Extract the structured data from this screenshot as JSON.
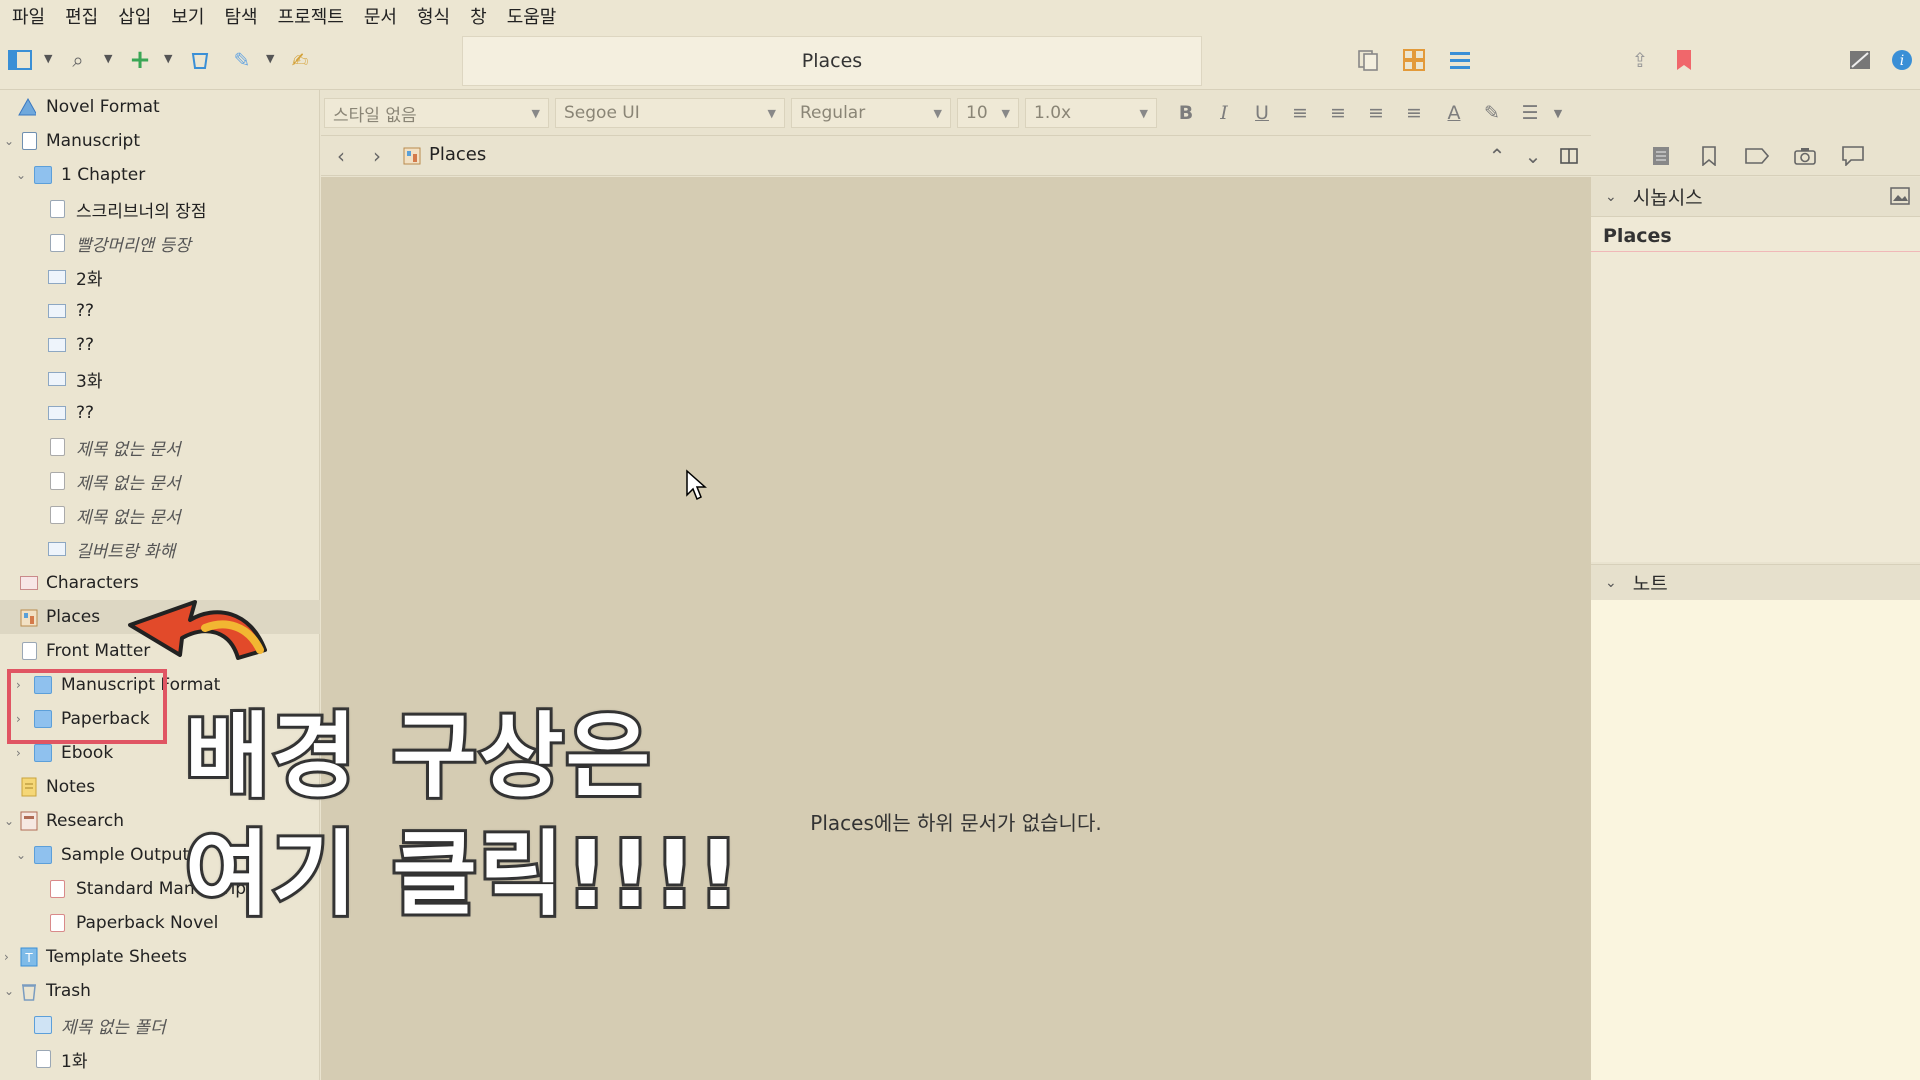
{
  "menu": [
    "파일",
    "편집",
    "삽입",
    "보기",
    "탐색",
    "프로젝트",
    "문서",
    "형식",
    "창",
    "도움말"
  ],
  "window": {
    "title": "Places"
  },
  "binder": {
    "items": [
      {
        "label": "Novel Format",
        "icon": "warning-icon"
      },
      {
        "label": "Manuscript",
        "icon": "manuscript-icon"
      },
      {
        "label": "1 Chapter",
        "icon": "folder-icon"
      },
      {
        "label": "스크리브너의 장점",
        "icon": "document-icon"
      },
      {
        "label": "빨강머리앤 등장",
        "icon": "document-icon"
      },
      {
        "label": "2화",
        "icon": "card-icon"
      },
      {
        "label": "??",
        "icon": "card-icon"
      },
      {
        "label": "??",
        "icon": "card-icon"
      },
      {
        "label": "3화",
        "icon": "card-icon"
      },
      {
        "label": "??",
        "icon": "card-icon"
      },
      {
        "label": "제목 없는 문서",
        "icon": "blank-document-icon"
      },
      {
        "label": "제목 없는 문서",
        "icon": "blank-document-icon"
      },
      {
        "label": "제목 없는 문서",
        "icon": "blank-document-icon"
      },
      {
        "label": "길버트랑 화해",
        "icon": "card-icon"
      },
      {
        "label": "Characters",
        "icon": "characters-icon"
      },
      {
        "label": "Places",
        "icon": "places-icon"
      },
      {
        "label": "Front Matter",
        "icon": "folder-icon"
      },
      {
        "label": "Manuscript Format",
        "icon": "folder-icon"
      },
      {
        "label": "Paperback",
        "icon": "folder-icon"
      },
      {
        "label": "Ebook",
        "icon": "folder-icon"
      },
      {
        "label": "Notes",
        "icon": "notes-icon"
      },
      {
        "label": "Research",
        "icon": "research-icon"
      },
      {
        "label": "Sample Output",
        "icon": "folder-icon"
      },
      {
        "label": "Standard Manuscript",
        "icon": "pdf-icon"
      },
      {
        "label": "Paperback Novel",
        "icon": "pdf-icon"
      },
      {
        "label": "Template Sheets",
        "icon": "template-icon"
      },
      {
        "label": "Trash",
        "icon": "trash-icon"
      },
      {
        "label": "제목 없는 폴더",
        "icon": "folder-icon"
      },
      {
        "label": "1화",
        "icon": "document-icon"
      }
    ]
  },
  "format": {
    "style": "스타일 없음",
    "font": "Segoe UI",
    "weight": "Regular",
    "size": "10",
    "spacing": "1.0x"
  },
  "nav": {
    "crumb": "Places"
  },
  "editor": {
    "empty_message": "Places에는 하위 문서가 없습니다."
  },
  "inspector": {
    "synopsis_header": "시놉시스",
    "synopsis_title": "Places",
    "notes_header": "노트"
  },
  "overlay": {
    "line1": "배경 구상은",
    "line2": "여기 클릭!!!!"
  },
  "colors": {
    "accent": "#3a8fd6",
    "highlight": "#e05563",
    "bookmark": "#f0676b"
  }
}
